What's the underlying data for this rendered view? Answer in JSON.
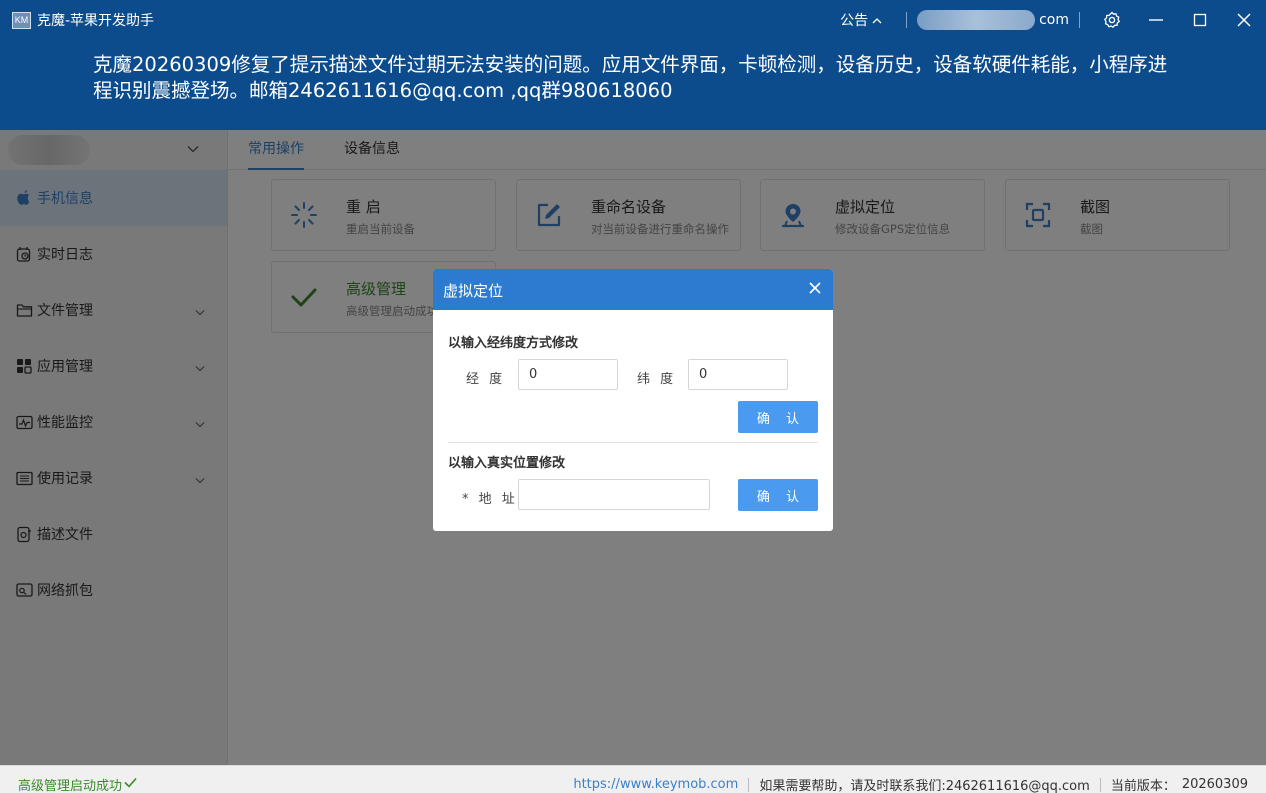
{
  "window": {
    "logo_text": "KM",
    "title": "克魔-苹果开发助手",
    "notice_label": "公告",
    "account_suffix": "com"
  },
  "banner": {
    "text": "克魔20260309修复了提示描述文件过期无法安装的问题。应用文件界面，卡顿检测，设备历史，设备软硬件耗能，小程序进程识别震撼登场。邮箱2462611616@qq.com ,qq群980618060"
  },
  "sidebar": {
    "items": [
      {
        "label": "手机信息",
        "icon": "apple-icon",
        "active": true,
        "expandable": false
      },
      {
        "label": "实时日志",
        "icon": "log-icon",
        "active": false,
        "expandable": false
      },
      {
        "label": "文件管理",
        "icon": "folder-icon",
        "active": false,
        "expandable": true
      },
      {
        "label": "应用管理",
        "icon": "apps-icon",
        "active": false,
        "expandable": true
      },
      {
        "label": "性能监控",
        "icon": "performance-icon",
        "active": false,
        "expandable": true
      },
      {
        "label": "使用记录",
        "icon": "records-icon",
        "active": false,
        "expandable": true
      },
      {
        "label": "描述文件",
        "icon": "profile-icon",
        "active": false,
        "expandable": false
      },
      {
        "label": "网络抓包",
        "icon": "network-icon",
        "active": false,
        "expandable": false
      }
    ]
  },
  "tabs": [
    {
      "label": "常用操作",
      "active": true
    },
    {
      "label": "设备信息",
      "active": false
    }
  ],
  "cards": [
    {
      "title": "重 启",
      "subtitle": "重启当前设备",
      "icon": "restart-icon"
    },
    {
      "title": "重命名设备",
      "subtitle": "对当前设备进行重命名操作",
      "icon": "rename-icon"
    },
    {
      "title": "虚拟定位",
      "subtitle": "修改设备GPS定位信息",
      "icon": "location-icon"
    },
    {
      "title": "截图",
      "subtitle": "截图",
      "icon": "screenshot-icon"
    },
    {
      "title": "高级管理",
      "subtitle": "高级管理启动成功",
      "icon": "check-icon"
    }
  ],
  "dialog": {
    "title": "虚拟定位",
    "section1_title": "以输入经纬度方式修改",
    "longitude_label": "经 度",
    "longitude_value": "0",
    "latitude_label": "纬 度",
    "latitude_value": "0",
    "confirm1_label": "确 认",
    "section2_title": "以输入真实位置修改",
    "address_label": "* 地 址",
    "address_value": "",
    "confirm2_label": "确 认"
  },
  "statusbar": {
    "left_text": "高级管理启动成功",
    "website": "https://www.keymob.com",
    "help_text": "如果需要帮助，请及时联系我们:2462611616@qq.com",
    "version_label": "当前版本：",
    "version_value": "20260309"
  },
  "colors": {
    "titlebar": "#0d4c8c",
    "accent": "#3c80c8",
    "dialog_header": "#2d7bd0",
    "button": "#4a9af0",
    "success": "#3a8a2a"
  }
}
